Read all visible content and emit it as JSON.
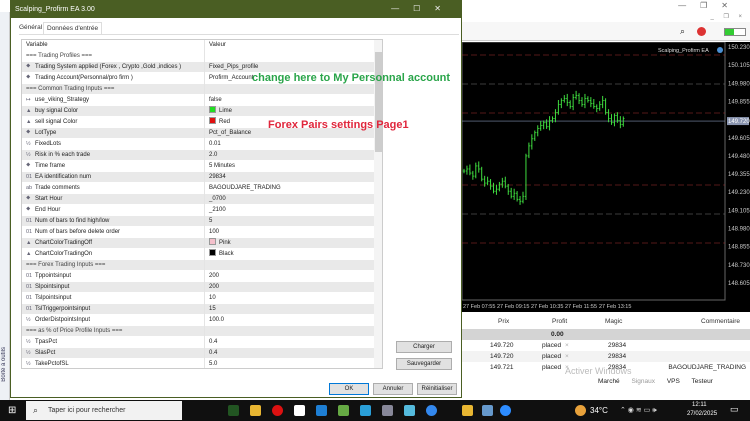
{
  "dialog": {
    "title": "Scalping_Profirm EA 3.00",
    "tabs": [
      "Général",
      "Données d'entrée"
    ],
    "col_variable": "Variable",
    "col_value": "Valeur",
    "params": [
      {
        "name": "=== Trading Profiles ===",
        "value": "",
        "section": true
      },
      {
        "icon": "enum",
        "name": "Trading System applied (Forex , Crypto ,Gold ,indices )",
        "value": "Fixed_Pips_profile"
      },
      {
        "icon": "enum",
        "name": "Trading Account(Personnal/pro firm )",
        "value": "Profirm_Account"
      },
      {
        "name": "=== Common Trading  Inputs ===",
        "value": "",
        "section": true
      },
      {
        "icon": "bool",
        "name": "use_viking_Strategy",
        "value": "false"
      },
      {
        "icon": "color",
        "name": "buy signal Color",
        "value": "Lime",
        "swatch": "#22dd22"
      },
      {
        "icon": "color",
        "name": "sell signal Color",
        "value": "Red",
        "swatch": "#e01010"
      },
      {
        "icon": "enum",
        "name": "LotType",
        "value": "Pct_of_Balance"
      },
      {
        "icon": "double",
        "name": "FixedLots",
        "value": "0.01"
      },
      {
        "icon": "double",
        "name": "Risk in % each trade",
        "value": "2.0"
      },
      {
        "icon": "enum",
        "name": "Time frame",
        "value": "5 Minutes"
      },
      {
        "icon": "int",
        "name": "EA identification num",
        "value": "29834"
      },
      {
        "icon": "string",
        "name": "Trade comments",
        "value": "BAGOUDJARE_TRADING"
      },
      {
        "icon": "enum",
        "name": "Start Hour",
        "value": "_0700"
      },
      {
        "icon": "enum",
        "name": "End Hour",
        "value": "_2100"
      },
      {
        "icon": "int",
        "name": "Num of bars to find high/low",
        "value": "5"
      },
      {
        "icon": "int",
        "name": "Num of bars before delete order",
        "value": "100"
      },
      {
        "icon": "color",
        "name": "ChartColorTradingOff",
        "value": "Pink",
        "swatch": "#f4c0cb"
      },
      {
        "icon": "color",
        "name": "ChartColorTradingOn",
        "value": "Black",
        "swatch": "#000000"
      },
      {
        "name": "=== Forex Trading  Inputs ===",
        "value": "",
        "section": true
      },
      {
        "icon": "int",
        "name": "Tppointsinput",
        "value": "200"
      },
      {
        "icon": "int",
        "name": "Slpointsinput",
        "value": "200"
      },
      {
        "icon": "int",
        "name": "Tslpointsinput",
        "value": "10"
      },
      {
        "icon": "int",
        "name": "TslTriggerpointsinput",
        "value": "15"
      },
      {
        "icon": "double",
        "name": "OrderDistpointsInput",
        "value": "100.0"
      },
      {
        "name": "=== as  % of Price Profile Inputs ===",
        "value": "",
        "section": true
      },
      {
        "icon": "double",
        "name": "TpasPct",
        "value": "0.4"
      },
      {
        "icon": "double",
        "name": "SlasPct",
        "value": "0.4"
      },
      {
        "icon": "double",
        "name": "TakePctofSL",
        "value": "5.0"
      }
    ],
    "load_label": "Charger",
    "save_label": "Sauvegarder",
    "ok_label": "OK",
    "cancel_label": "Annuler",
    "reset_label": "Réinitialiser"
  },
  "icons": {
    "enum": "⯁",
    "bool": "↦",
    "color": "▲",
    "double": "½",
    "int": "01",
    "string": "ab"
  },
  "annotations": {
    "account_note": "change here to My Personnal account",
    "page_note": "Forex Pairs settings Page1"
  },
  "chart": {
    "ea_label": "Scalping_Profirm EA",
    "current_price": "149.720",
    "price_ticks": [
      "150.230",
      "150.105",
      "149.980",
      "149.855",
      "149.720",
      "149.605",
      "149.480",
      "149.355",
      "149.230",
      "149.105",
      "148.980",
      "148.855",
      "148.730",
      "148.605"
    ],
    "time_ticks": [
      "27 Feb 07:55",
      "27 Feb 09:15",
      "27 Feb 10:35",
      "27 Feb 11:55",
      "27 Feb 13:15"
    ]
  },
  "chart_data": {
    "type": "line",
    "series": [
      {
        "name": "close",
        "values": [
          149.376,
          149.39,
          149.362,
          149.341,
          149.411,
          149.39,
          149.32,
          149.293,
          149.306,
          149.272,
          149.237,
          149.251,
          149.286,
          149.306,
          149.272,
          149.237,
          149.202,
          149.223,
          149.181,
          149.168,
          149.202,
          149.48,
          149.549,
          149.598,
          149.64,
          149.668,
          149.689,
          149.709,
          149.681,
          149.723,
          149.737,
          149.779,
          149.834,
          149.862,
          149.876,
          149.848,
          149.82,
          149.883,
          149.897,
          149.862,
          149.834,
          149.876,
          149.862,
          149.841,
          149.82,
          149.806,
          149.834,
          149.862,
          149.779,
          149.737,
          149.709,
          149.758,
          149.723,
          149.696,
          149.737
        ]
      }
    ],
    "ylim": [
      148.605,
      150.23
    ]
  },
  "trades": {
    "headers": [
      "Prix",
      "Profit",
      "Magic",
      "Commentaire"
    ],
    "total_profit": "0.00",
    "rows": [
      {
        "price": "149.720",
        "profit": "placed",
        "magic": "29834",
        "comment": ""
      },
      {
        "price": "149.720",
        "profit": "placed",
        "magic": "29834",
        "comment": ""
      },
      {
        "price": "149.721",
        "profit": "placed",
        "magic": "29834",
        "comment": "BAGOUDJARE_TRADING"
      }
    ]
  },
  "status_tabs": [
    "Marché",
    "Signaux",
    "VPS",
    "Testeur"
  ],
  "watermark": "Activer Windows",
  "toolbox_label": "Boîte à outils",
  "taskbar": {
    "search_placeholder": "Taper ici pour rechercher",
    "temperature": "34°C",
    "time": "12:11",
    "date": "27/02/2025"
  }
}
